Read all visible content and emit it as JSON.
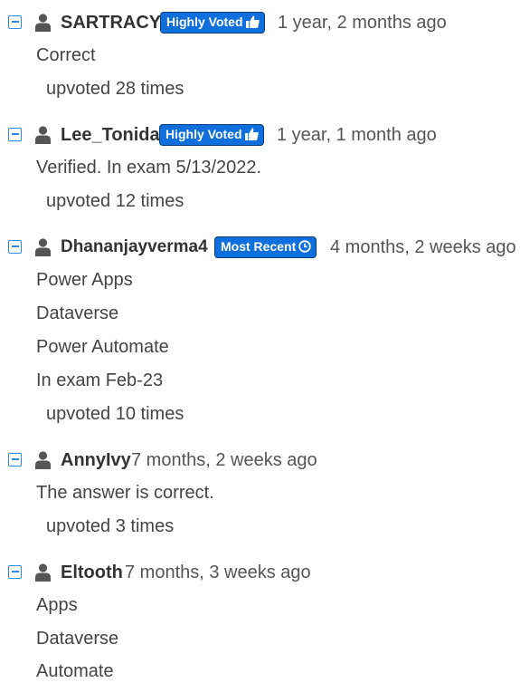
{
  "badges": {
    "highly_voted": "Highly Voted",
    "most_recent": "Most Recent"
  },
  "colors": {
    "accent": "#2d8ae6",
    "badge_bg": "#0f6fdc",
    "badge_border": "#073f80",
    "text": "#444444"
  },
  "comments": [
    {
      "username": "SARTRACY",
      "badge": "Highly Voted",
      "badge_icon": "thumbs-up-icon",
      "date": "1 year, 2 months ago",
      "lines": [
        "Correct"
      ],
      "upvotes": "upvoted 28 times"
    },
    {
      "username": "Lee_Tonida",
      "badge": "Highly Voted",
      "badge_icon": "thumbs-up-icon",
      "date": "1 year, 1 month ago",
      "lines": [
        "Verified. In exam 5/13/2022."
      ],
      "upvotes": "upvoted 12 times"
    },
    {
      "username": "Dhananjayverma4",
      "badge": "Most Recent",
      "badge_icon": "clock-icon",
      "date": "4 months, 2 weeks ago",
      "lines": [
        "Power Apps",
        "Dataverse",
        "Power Automate",
        "In exam Feb-23"
      ],
      "upvotes": "upvoted 10 times"
    },
    {
      "username": "AnnyIvy",
      "date": "7 months, 2 weeks ago",
      "lines": [
        "The answer is correct."
      ],
      "upvotes": "upvoted 3 times"
    },
    {
      "username": "Eltooth",
      "date": "7 months, 3 weeks ago",
      "lines": [
        "Apps",
        "Dataverse",
        "Automate"
      ]
    }
  ]
}
